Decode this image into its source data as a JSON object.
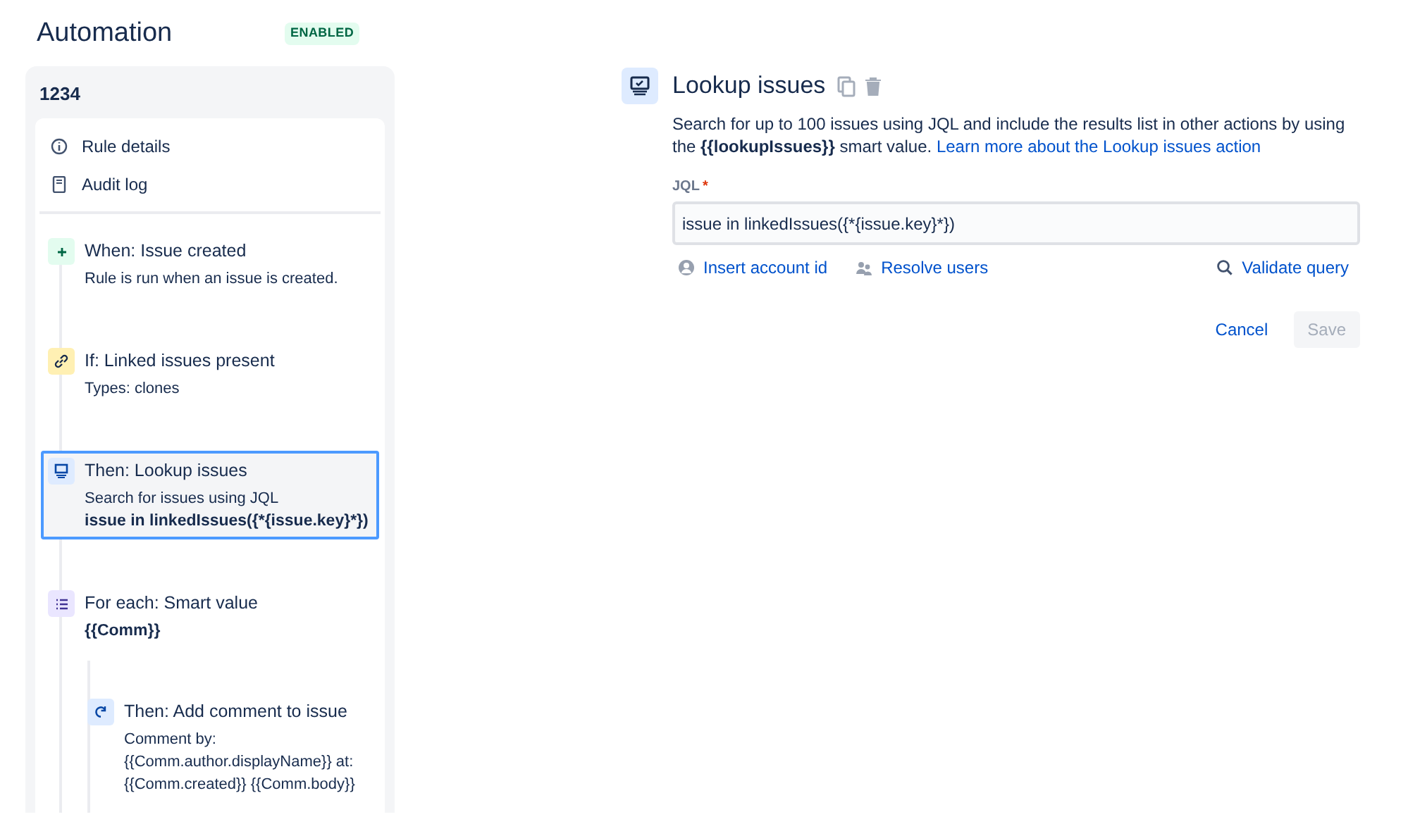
{
  "header": {
    "title": "Automation",
    "status": "ENABLED"
  },
  "rule": {
    "name": "1234",
    "links": [
      {
        "kind": "info",
        "label": "Rule details"
      },
      {
        "kind": "log",
        "label": "Audit log"
      }
    ],
    "components": [
      {
        "kind": "trigger",
        "title": "When: Issue created",
        "selected": false,
        "lines": [
          {
            "text": "Rule is run when an issue is created.",
            "strong": false
          }
        ]
      },
      {
        "kind": "condition",
        "title": "If: Linked issues present",
        "selected": false,
        "lines": [
          {
            "text": "Types: clones",
            "strong": false
          }
        ]
      },
      {
        "kind": "action",
        "title": "Then: Lookup issues",
        "selected": true,
        "lines": [
          {
            "text": "Search for issues using JQL",
            "strong": false
          },
          {
            "text": "issue in linkedIssues({*{issue.key}*})",
            "strong": true
          }
        ]
      },
      {
        "kind": "branch",
        "title": "For each: Smart value",
        "selected": false,
        "lines": [
          {
            "text": "{{Comm}}",
            "strong": true
          }
        ],
        "children": [
          {
            "kind": "comment",
            "title": "Then: Add comment to issue",
            "selected": false,
            "lines": [
              {
                "text": "Comment by: {{Comm.author.displayName}} at: {{Comm.created}} {{Comm.body}}",
                "strong": false
              }
            ]
          }
        ]
      }
    ]
  },
  "editor": {
    "title": "Lookup issues",
    "description": "Search for up to 100 issues using JQL and include the results list in other actions by using the **{{lookupIssues}}** smart value.",
    "link": "Learn more about the Lookup issues action",
    "field": {
      "label": "JQL",
      "required_mark": "*",
      "value": "issue in linkedIssues({*{issue.key}*})"
    },
    "tools": [
      {
        "kind": "account",
        "label": "Insert account id"
      },
      {
        "kind": "users",
        "label": "Resolve users"
      },
      {
        "kind": "validate",
        "label": "Validate query"
      }
    ],
    "buttons": [
      {
        "label": "Cancel",
        "disabled": false
      },
      {
        "label": "Save",
        "disabled": true
      }
    ]
  }
}
